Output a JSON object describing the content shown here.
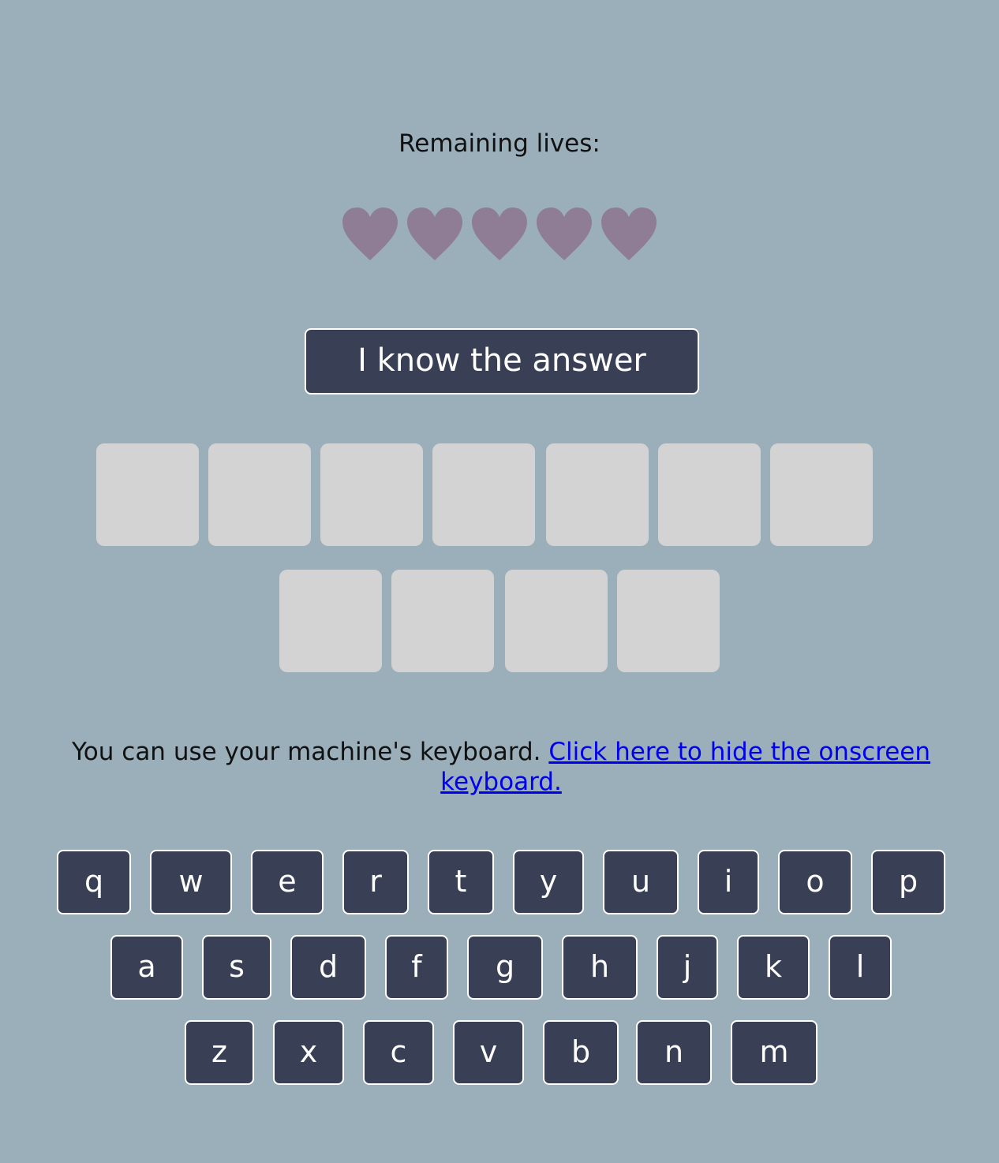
{
  "lives": {
    "label": "Remaining lives:",
    "count": 5,
    "icon": "heart-icon",
    "heart_color": "#8f7c95"
  },
  "answer_button": {
    "label": "I know the answer"
  },
  "word": {
    "letters": [
      "",
      "",
      "",
      "",
      "",
      "",
      "",
      "",
      "",
      "",
      ""
    ]
  },
  "keyboard_note": {
    "text": "You can use your machine's keyboard. ",
    "link": "Click here to hide the onscreen keyboard."
  },
  "keyboard": {
    "row1": [
      "q",
      "w",
      "e",
      "r",
      "t",
      "y",
      "u",
      "i",
      "o",
      "p"
    ],
    "row2": [
      "a",
      "s",
      "d",
      "f",
      "g",
      "h",
      "j",
      "k",
      "l"
    ],
    "row3": [
      "z",
      "x",
      "c",
      "v",
      "b",
      "n",
      "m"
    ]
  },
  "colors": {
    "background": "#9aafba",
    "key_background": "#393f55",
    "tile_background": "#d3d3d3",
    "link": "#0000ee"
  }
}
